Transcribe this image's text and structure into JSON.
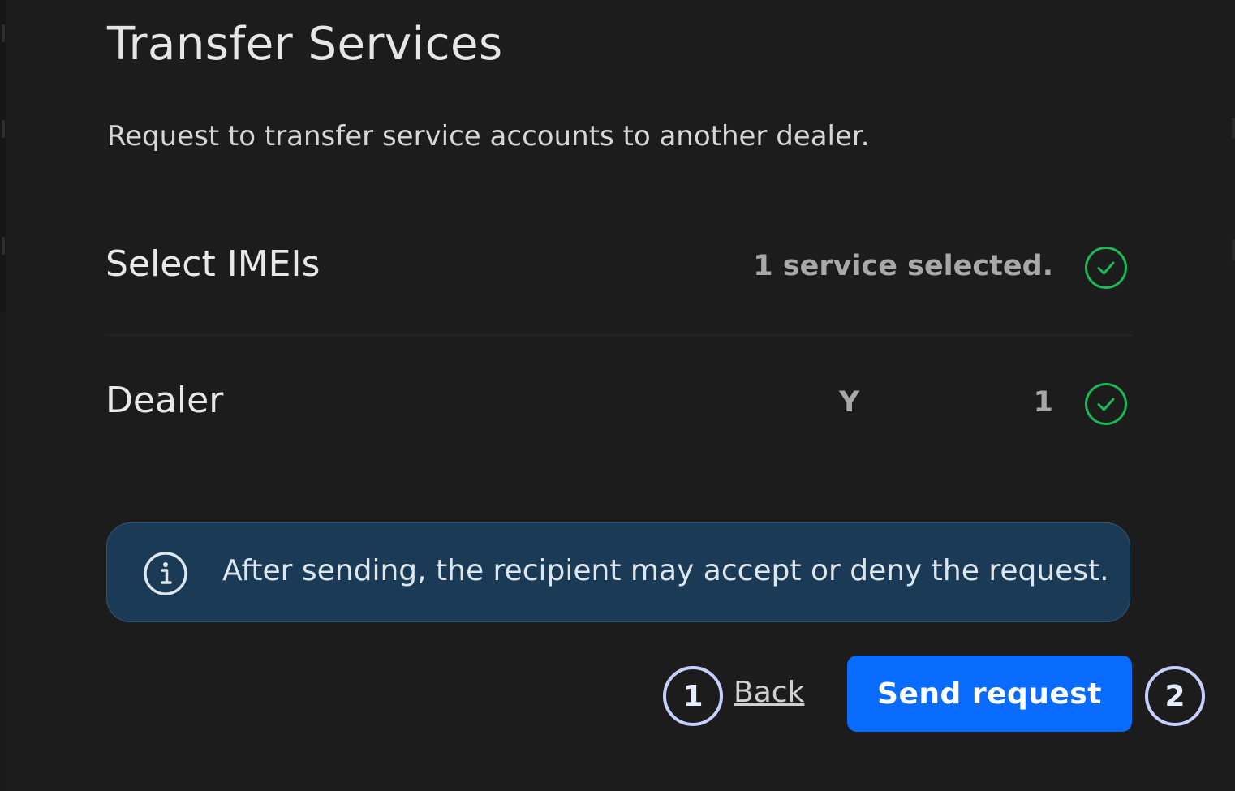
{
  "dialog": {
    "title": "Transfer Services",
    "subtitle": "Request to transfer service accounts to another dealer."
  },
  "rows": [
    {
      "label": "Select IMEIs",
      "value": "1 service selected.",
      "status_icon": "check-circle-icon",
      "status_color": "#1db954"
    },
    {
      "label": "Dealer",
      "value_name": "Y",
      "value_count": "1",
      "status_icon": "check-circle-icon",
      "status_color": "#1db954"
    }
  ],
  "info": {
    "icon": "info-icon",
    "text": "After sending, the recipient may accept or deny the request."
  },
  "actions": {
    "back_label": "Back",
    "send_label": "Send request",
    "primary_color": "#0a6cff"
  },
  "markers": [
    "1",
    "2"
  ]
}
